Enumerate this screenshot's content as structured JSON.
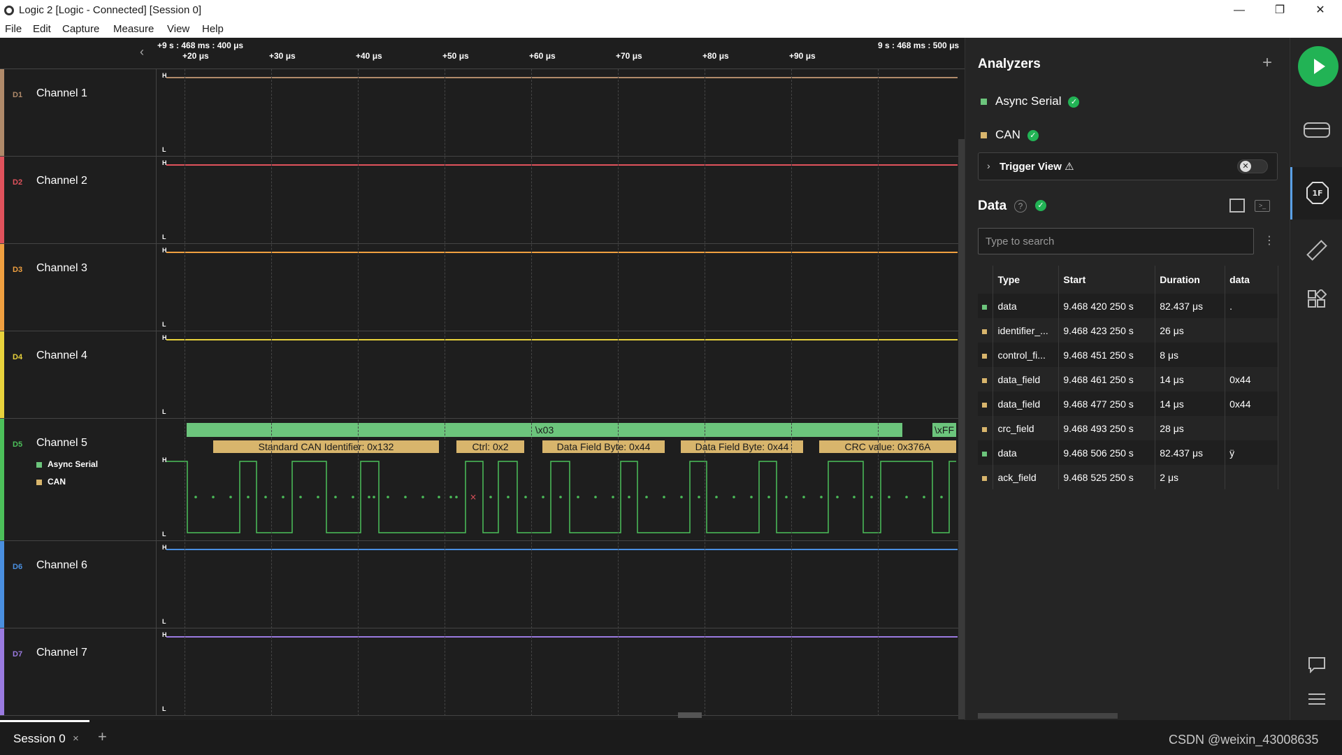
{
  "window": {
    "title": "Logic 2 [Logic - Connected] [Session 0]",
    "minimize": "—",
    "maximize": "❐",
    "close": "✕"
  },
  "menu": [
    "File",
    "Edit",
    "Capture",
    "Measure",
    "View",
    "Help"
  ],
  "timeline": {
    "start_ts": "+9 s : 468 ms : 400 μs",
    "end_ts": "9 s : 468 ms : 500 μs",
    "ticks": [
      "+20 μs",
      "+30 μs",
      "+40 μs",
      "+50 μs",
      "+60 μs",
      "+70 μs",
      "+80 μs",
      "+90 μs"
    ]
  },
  "channels": [
    {
      "id": "D1",
      "name": "Channel 1",
      "color": "#b08a6a"
    },
    {
      "id": "D2",
      "name": "Channel 2",
      "color": "#e0525c"
    },
    {
      "id": "D3",
      "name": "Channel 3",
      "color": "#f0a040"
    },
    {
      "id": "D4",
      "name": "Channel 4",
      "color": "#e8d23c"
    },
    {
      "id": "D5",
      "name": "Channel 5",
      "color": "#4cc05a"
    },
    {
      "id": "D6",
      "name": "Channel 6",
      "color": "#4a8fe0"
    },
    {
      "id": "D7",
      "name": "Channel 7",
      "color": "#9a7ae0"
    }
  ],
  "signal_labels": {
    "high": "H",
    "low": "L"
  },
  "channel5_analyzers": [
    "Async Serial",
    "CAN"
  ],
  "async_frames": [
    "\\x03",
    "\\xFF"
  ],
  "can_frames": [
    "Standard CAN Identifier: 0x132",
    "Ctrl: 0x2",
    "Data Field Byte: 0x44",
    "Data Field Byte: 0x44",
    "CRC value: 0x376A"
  ],
  "analyzers_panel": {
    "title": "Analyzers",
    "add": "+",
    "analyzers": [
      {
        "name": "Async Serial",
        "color": "#6cc57c"
      },
      {
        "name": "CAN",
        "color": "#d8b56c"
      }
    ],
    "trigger_view": "Trigger View ⚠",
    "trigger_toggle": "✕"
  },
  "data_panel": {
    "title": "Data",
    "help": "?",
    "search_placeholder": "Type to search",
    "menu": "⋮",
    "terminal": ">_",
    "columns": [
      "Type",
      "Start",
      "Duration",
      "data"
    ],
    "rows": [
      {
        "color": "#6cc57c",
        "type": "data",
        "start": "9.468 420 250 s",
        "duration": "82.437 μs",
        "data": "."
      },
      {
        "color": "#d8b56c",
        "type": "identifier_...",
        "start": "9.468 423 250 s",
        "duration": "26 μs",
        "data": ""
      },
      {
        "color": "#d8b56c",
        "type": "control_fi...",
        "start": "9.468 451 250 s",
        "duration": "8 μs",
        "data": ""
      },
      {
        "color": "#d8b56c",
        "type": "data_field",
        "start": "9.468 461 250 s",
        "duration": "14 μs",
        "data": "0x44"
      },
      {
        "color": "#d8b56c",
        "type": "data_field",
        "start": "9.468 477 250 s",
        "duration": "14 μs",
        "data": "0x44"
      },
      {
        "color": "#d8b56c",
        "type": "crc_field",
        "start": "9.468 493 250 s",
        "duration": "28 μs",
        "data": ""
      },
      {
        "color": "#6cc57c",
        "type": "data",
        "start": "9.468 506 250 s",
        "duration": "82.437 μs",
        "data": "ÿ"
      },
      {
        "color": "#d8b56c",
        "type": "ack_field",
        "start": "9.468 525 250 s",
        "duration": "2 μs",
        "data": ""
      }
    ]
  },
  "sidebar": {
    "icons": [
      "play-icon",
      "device-icon",
      "analyzers-icon",
      "measure-icon",
      "extensions-icon",
      "notes-icon",
      "menu-icon"
    ],
    "analyzers_badge": "1F"
  },
  "bottom": {
    "session": "Session 0",
    "session_close": "×",
    "add": "+",
    "watermark": "CSDN @weixin_43008635"
  }
}
